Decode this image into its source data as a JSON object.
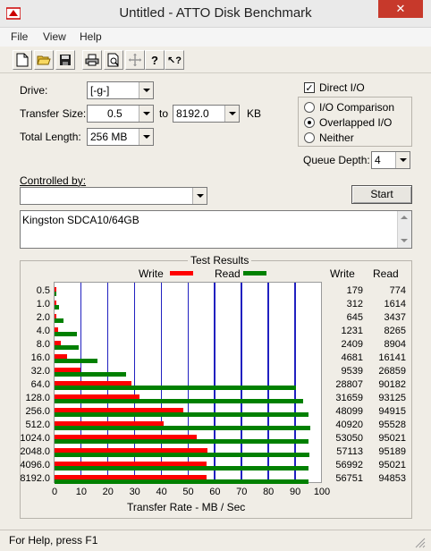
{
  "window": {
    "title": "Untitled - ATTO Disk Benchmark",
    "close_label": "✕"
  },
  "menu": [
    "File",
    "View",
    "Help"
  ],
  "toolbar": {
    "icons": [
      "new-file-icon",
      "open-folder-icon",
      "save-icon",
      "print-icon",
      "print-preview-icon",
      "move-icon",
      "help-icon",
      "context-help-icon"
    ],
    "help_glyph": "?",
    "context_help_glyph": "?"
  },
  "form": {
    "drive_label": "Drive:",
    "drive_value": "[-g-]",
    "transfer_size_label": "Transfer Size:",
    "transfer_from": "0.5",
    "to_label": "to",
    "transfer_to": "8192.0",
    "kb_label": "KB",
    "total_length_label": "Total Length:",
    "total_length_value": "256 MB",
    "controlled_by_label": "Controlled by:",
    "controlled_by_value": "",
    "start_label": "Start",
    "description": "Kingston SDCA10/64GB"
  },
  "options": {
    "direct_io_label": "Direct I/O",
    "direct_io_checked": true,
    "io_comparison_label": "I/O Comparison",
    "overlapped_io_label": "Overlapped I/O",
    "neither_label": "Neither",
    "selected": "overlapped",
    "queue_depth_label": "Queue Depth:",
    "queue_depth_value": "4"
  },
  "chart_data": {
    "type": "bar",
    "title": "Test Results",
    "legend": [
      {
        "name": "Write",
        "color": "#ff0000"
      },
      {
        "name": "Read",
        "color": "#008000"
      }
    ],
    "legend_placement": "top",
    "categories": [
      "0.5",
      "1.0",
      "2.0",
      "4.0",
      "8.0",
      "16.0",
      "32.0",
      "64.0",
      "128.0",
      "256.0",
      "512.0",
      "1024.0",
      "2048.0",
      "4096.0",
      "8192.0"
    ],
    "series": [
      {
        "name": "Write",
        "values": [
          179,
          312,
          645,
          1231,
          2409,
          4681,
          9539,
          28807,
          31659,
          48099,
          40920,
          53050,
          57113,
          56992,
          56751
        ]
      },
      {
        "name": "Read",
        "values": [
          774,
          1614,
          3437,
          8265,
          8904,
          16141,
          26859,
          90182,
          93125,
          94915,
          95528,
          95021,
          95189,
          95021,
          94853
        ]
      }
    ],
    "write_header": "Write",
    "read_header": "Read",
    "xlabel": "Transfer Rate - MB / Sec",
    "xticks": [
      "0",
      "10",
      "20",
      "30",
      "40",
      "50",
      "60",
      "70",
      "80",
      "90",
      "100"
    ],
    "xlim": [
      0,
      100
    ],
    "grid": true
  },
  "status": {
    "text": "For Help, press F1"
  }
}
